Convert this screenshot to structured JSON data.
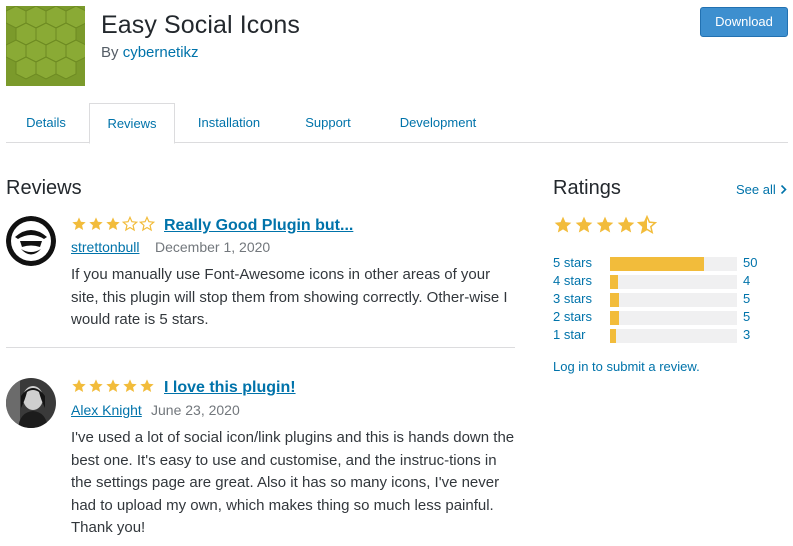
{
  "header": {
    "title": "Easy Social Icons",
    "author_prefix": "By",
    "author": "cybernetikz",
    "download_label": "Download"
  },
  "tabs": [
    {
      "label": "Details"
    },
    {
      "label": "Reviews",
      "active": true
    },
    {
      "label": "Installation"
    },
    {
      "label": "Support"
    },
    {
      "label": "Development"
    }
  ],
  "reviews_section": {
    "title": "Reviews",
    "items": [
      {
        "title": "Really Good Plugin but...",
        "author": "strettonbull",
        "date": "December 1, 2020",
        "stars": 3,
        "body": "If you manually use Font-Awesome icons in other areas of your site, this plugin will stop them from showing correctly. Other-wise I would rate is 5 stars."
      },
      {
        "title": "I love this plugin!",
        "author": "Alex Knight",
        "date": "June 23, 2020",
        "stars": 5,
        "body": "I've used a lot of social icon/link plugins and this is hands down the best one. It's easy to use and customise, and the instruc-tions in the settings page are great. Also it has so many icons, I've never had to upload my own, which makes thing so much less painful. Thank you!"
      }
    ]
  },
  "ratings": {
    "title": "Ratings",
    "see_all": "See all",
    "average_stars": 4.5,
    "rows": [
      {
        "label": "5 stars",
        "count": "50",
        "fraction": 0.74
      },
      {
        "label": "4 stars",
        "count": "4",
        "fraction": 0.06
      },
      {
        "label": "3 stars",
        "count": "5",
        "fraction": 0.07
      },
      {
        "label": "2 stars",
        "count": "5",
        "fraction": 0.07
      },
      {
        "label": "1 star",
        "count": "3",
        "fraction": 0.05
      }
    ],
    "login_link": "Log in to submit a review."
  },
  "colors": {
    "star": "#f2bc3b",
    "link": "#0073aa",
    "button": "#3d8fcf"
  }
}
